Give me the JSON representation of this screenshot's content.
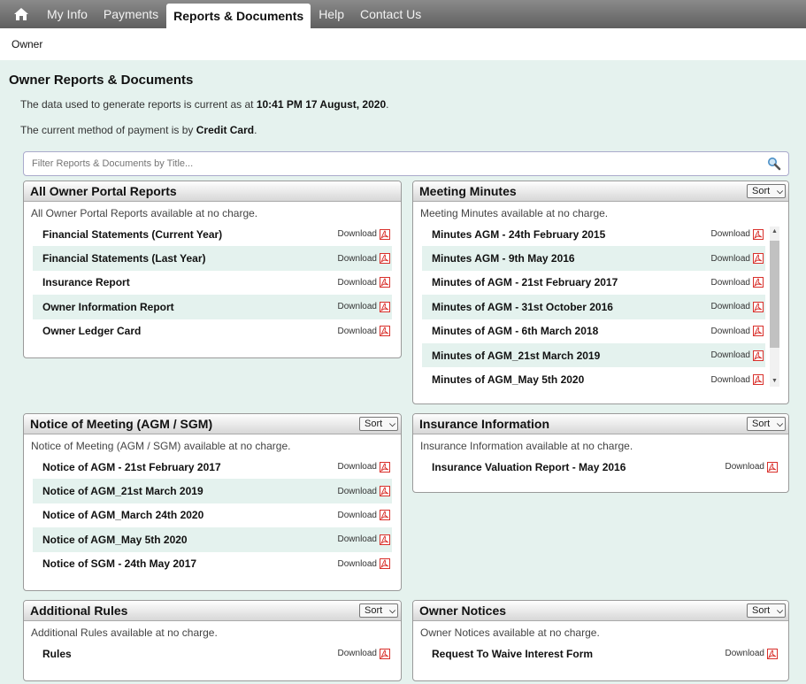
{
  "nav": {
    "tabs": [
      {
        "label": "My Info"
      },
      {
        "label": "Payments"
      },
      {
        "label": "Reports & Documents"
      },
      {
        "label": "Help"
      },
      {
        "label": "Contact Us"
      }
    ]
  },
  "breadcrumb": "Owner",
  "page": {
    "title": "Owner Reports & Documents",
    "data_current_prefix": "The data used to generate reports is current as at ",
    "data_current_value": "10:41 PM 17 August, 2020",
    "data_current_suffix": ".",
    "payment_prefix": "The current method of payment is by ",
    "payment_value": "Credit Card",
    "payment_suffix": "."
  },
  "filter": {
    "placeholder": "Filter Reports & Documents by Title..."
  },
  "download_label": "Download",
  "sort_label": "Sort",
  "panels": {
    "portal": {
      "title": "All Owner Portal Reports",
      "desc": "All Owner Portal Reports available at no charge.",
      "items": [
        "Financial Statements (Current Year)",
        "Financial Statements (Last Year)",
        "Insurance Report",
        "Owner Information Report",
        "Owner Ledger Card"
      ]
    },
    "minutes": {
      "title": "Meeting Minutes",
      "desc": "Meeting Minutes available at no charge.",
      "items": [
        "Minutes AGM - 24th February 2015",
        "Minutes AGM - 9th May 2016",
        "Minutes of AGM - 21st February 2017",
        "Minutes of AGM - 31st October 2016",
        "Minutes of AGM - 6th March 2018",
        "Minutes of AGM_21st March 2019",
        "Minutes of AGM_May 5th 2020"
      ]
    },
    "notice": {
      "title": "Notice of Meeting (AGM / SGM)",
      "desc": "Notice of Meeting (AGM / SGM) available at no charge.",
      "items": [
        "Notice of AGM - 21st February 2017",
        "Notice of AGM_21st March 2019",
        "Notice of AGM_March 24th 2020",
        "Notice of AGM_May 5th 2020",
        "Notice of SGM - 24th May 2017"
      ]
    },
    "insurance": {
      "title": "Insurance Information",
      "desc": "Insurance Information available at no charge.",
      "items": [
        "Insurance Valuation Report - May 2016"
      ]
    },
    "rules": {
      "title": "Additional Rules",
      "desc": "Additional Rules available at no charge.",
      "items": [
        "Rules"
      ]
    },
    "notices": {
      "title": "Owner Notices",
      "desc": "Owner Notices available at no charge.",
      "items": [
        "Request To Waive Interest Form"
      ]
    }
  },
  "colors": {
    "accent_bg": "#e5f2ee",
    "nav_bg": "#6e6e6e",
    "pdf_red": "#d9302b"
  },
  "icons": {
    "home": "home-icon",
    "search": "search-icon",
    "pdf": "pdf-icon"
  }
}
